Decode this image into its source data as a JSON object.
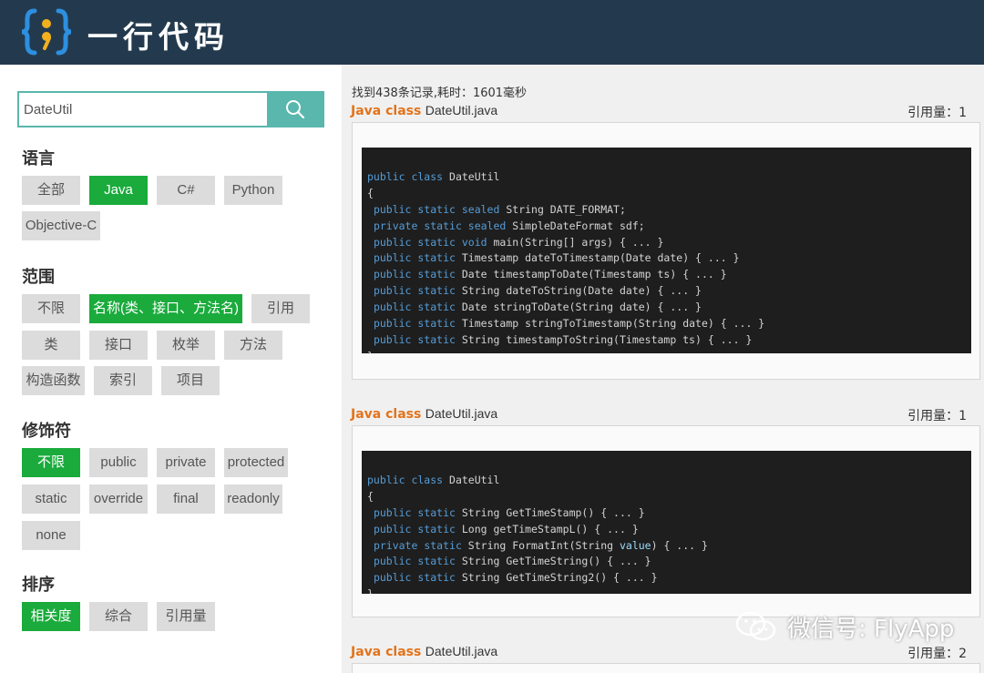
{
  "brand": {
    "name": "一行代码"
  },
  "search": {
    "value": "DateUtil"
  },
  "filters": {
    "language": {
      "title": "语言",
      "options": [
        "全部",
        "Java",
        "C#",
        "Python",
        "Objective-C"
      ],
      "selected": "Java"
    },
    "scope": {
      "title": "范围",
      "options": [
        "不限",
        "名称(类、接口、方法名)",
        "引用",
        "类",
        "接口",
        "枚举",
        "方法",
        "构造函数",
        "索引",
        "项目"
      ],
      "selected": "名称(类、接口、方法名)"
    },
    "modifier": {
      "title": "修饰符",
      "options": [
        "不限",
        "public",
        "private",
        "protected",
        "static",
        "override",
        "final",
        "readonly",
        "none"
      ],
      "selected": "不限"
    },
    "sort": {
      "title": "排序",
      "options": [
        "相关度",
        "综合",
        "引用量"
      ],
      "selected": "相关度"
    }
  },
  "results": {
    "stats": "找到438条记录,耗时：1601毫秒",
    "items": [
      {
        "kind": "Java class",
        "file": "DateUtil.java",
        "refs": "引用量：1",
        "code": [
          "public class DateUtil",
          "{",
          " public static sealed String DATE_FORMAT;",
          " private static sealed SimpleDateFormat sdf;",
          " public static void main(String[] args) { ... }",
          " public static Timestamp dateToTimestamp(Date date) { ... }",
          " public static Date timestampToDate(Timestamp ts) { ... }",
          " public static String dateToString(Date date) { ... }",
          " public static Date stringToDate(String date) { ... }",
          " public static Timestamp stringToTimestamp(String date) { ... }",
          " public static String timestampToString(Timestamp ts) { ... }",
          "}"
        ]
      },
      {
        "kind": "Java class",
        "file": "DateUtil.java",
        "refs": "引用量：1",
        "code": [
          "public class DateUtil",
          "{",
          " public static String GetTimeStamp() { ... }",
          " public static Long getTimeStampL() { ... }",
          " private static String FormatInt(String value) { ... }",
          " public static String GetTimeString() { ... }",
          " public static String GetTimeString2() { ... }",
          "}"
        ]
      },
      {
        "kind": "Java class",
        "file": "DateUtil.java",
        "refs": "引用量：2",
        "code": []
      }
    ]
  },
  "watermark": "微信号: FlyApp",
  "colors": {
    "header": "#233a4e",
    "accent": "#59b7ad",
    "active_chip": "#1aab3c",
    "keyword": "#e3731b"
  },
  "icons": {
    "logo": "braces-semicolon-logo-icon",
    "search": "search-icon",
    "watermark": "wechat-icon"
  }
}
